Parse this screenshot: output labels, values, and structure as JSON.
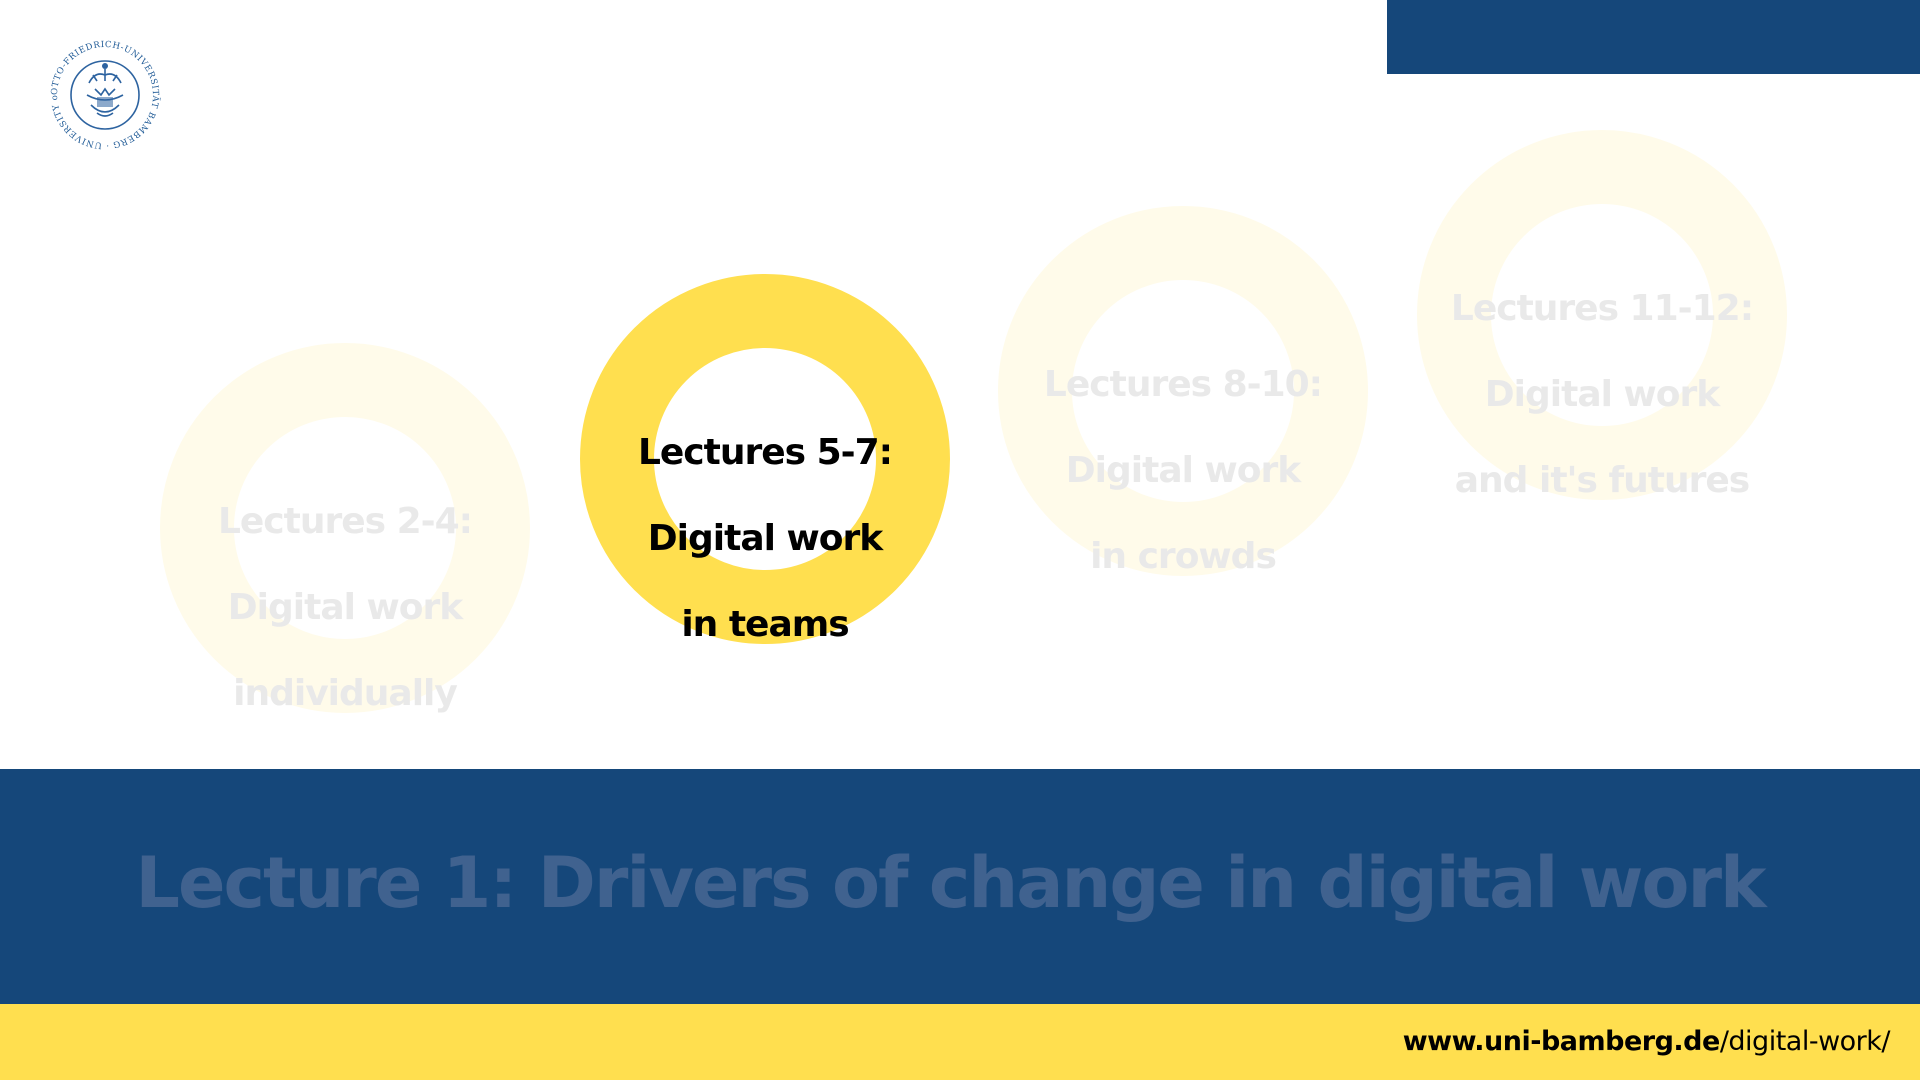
{
  "logo": {
    "text": "OTTO-FRIEDRICH-UNIVERSITÄT BAMBERG · UNIVERSITY of BAMBERG",
    "icon": "university-seal-icon"
  },
  "rings": [
    {
      "label_lines": [
        "Lectures 2-4:",
        "Digital work",
        "individually"
      ],
      "active": false
    },
    {
      "label_lines": [
        "Lectures 5-7:",
        "Digital work",
        "in teams"
      ],
      "active": true
    },
    {
      "label_lines": [
        "Lectures 8-10:",
        "Digital work",
        "in crowds"
      ],
      "active": false
    },
    {
      "label_lines": [
        "Lectures 11-12:",
        "Digital work",
        "and it's futures"
      ],
      "active": false
    }
  ],
  "band": {
    "title": "Lecture 1: Drivers of change in digital work"
  },
  "footer": {
    "url_domain": "www.uni-bamberg.de",
    "url_path": "/digital-work/"
  },
  "colors": {
    "navy": "#15477a",
    "yellow": "#ffdf4f",
    "faded_yellow": "#fffbea",
    "faded_text": "#e9e9e9",
    "band_text": "#40628f"
  }
}
